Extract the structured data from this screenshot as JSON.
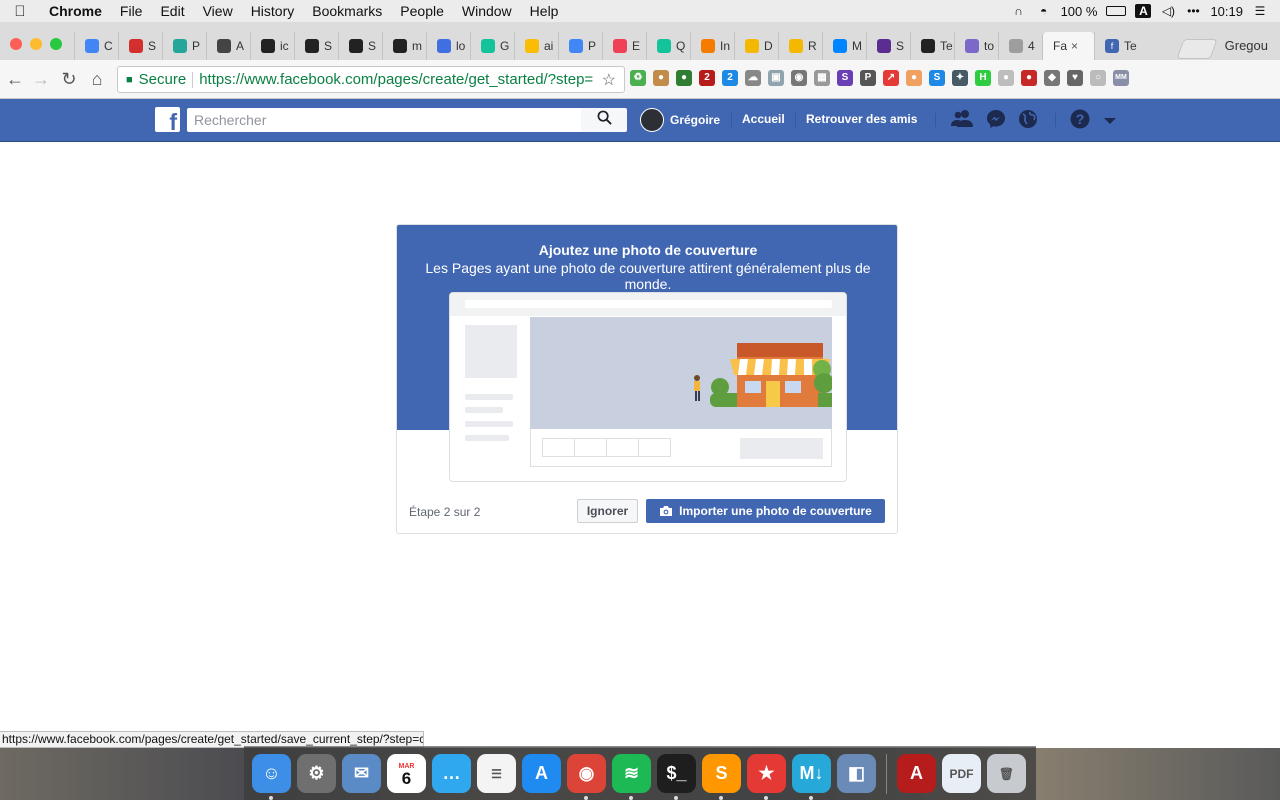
{
  "menubar": {
    "apple": "",
    "app_name": "Chrome",
    "items": [
      "File",
      "Edit",
      "View",
      "History",
      "Bookmarks",
      "People",
      "Window",
      "Help"
    ],
    "battery": "100 %",
    "input_source": "A",
    "clock": "10:19"
  },
  "browser": {
    "tabs": [
      {
        "label": "C",
        "icon": "google-docs-icon",
        "color": "#4285f4"
      },
      {
        "label": "S",
        "icon": "red-circle-icon",
        "color": "#d32f2f"
      },
      {
        "label": "P",
        "icon": "sheets-icon",
        "color": "#26a69a"
      },
      {
        "label": "A",
        "icon": "hat-icon",
        "color": "#444444"
      },
      {
        "label": "ic",
        "icon": "github-icon",
        "color": "#222222"
      },
      {
        "label": "S",
        "icon": "square-dark-icon",
        "color": "#222222"
      },
      {
        "label": "S",
        "icon": "square-dark-icon",
        "color": "#222222"
      },
      {
        "label": "m",
        "icon": "github-icon",
        "color": "#222222"
      },
      {
        "label": "lo",
        "icon": "circle-blue-icon",
        "color": "#3f6fe0"
      },
      {
        "label": "G",
        "icon": "grammarly-icon",
        "color": "#15c39a"
      },
      {
        "label": "ai",
        "icon": "google-drive-icon",
        "color": "#fbbc04"
      },
      {
        "label": "P",
        "icon": "google-docs-icon",
        "color": "#4285f4"
      },
      {
        "label": "E",
        "icon": "pocket-icon",
        "color": "#ef4056"
      },
      {
        "label": "Q",
        "icon": "grammarly-icon",
        "color": "#15c39a"
      },
      {
        "label": "In",
        "icon": "box-orange-icon",
        "color": "#f57c00"
      },
      {
        "label": "D",
        "icon": "box-yellow-icon",
        "color": "#f5b800"
      },
      {
        "label": "R",
        "icon": "box-yellow-icon",
        "color": "#f5b800"
      },
      {
        "label": "M",
        "icon": "messenger-icon",
        "color": "#0084ff"
      },
      {
        "label": "S",
        "icon": "purple-icon",
        "color": "#5c2d91"
      },
      {
        "label": "Te",
        "icon": "github-icon",
        "color": "#222222"
      },
      {
        "label": "to",
        "icon": "h-purple-icon",
        "color": "#7b68c8"
      },
      {
        "label": "4",
        "icon": "doc-outline-icon",
        "color": "#9e9e9e"
      }
    ],
    "active_tab": {
      "label": "Fa",
      "close": "×"
    },
    "last_tab": {
      "label": "Te",
      "icon": "facebook-icon",
      "color": "#4267b2"
    },
    "profile_name": "Gregou",
    "secure_label": "Secure",
    "url": "https://www.facebook.com/pages/create/get_started/?step=",
    "status_url": "https://www.facebook.com/pages/create/get_started/save_current_step/?step=cover",
    "extensions": [
      {
        "icon": "recycle-icon",
        "label": "♻",
        "color": "#4caf50"
      },
      {
        "icon": "cookie-icon",
        "label": "●",
        "color": "#c28b4a"
      },
      {
        "icon": "shield-green-icon",
        "label": "●",
        "color": "#2e7d32"
      },
      {
        "icon": "ublock-icon",
        "label": "2",
        "color": "#b71c1c"
      },
      {
        "icon": "s-badge-icon",
        "label": "2",
        "color": "#1e88e5"
      },
      {
        "icon": "cloud-icon",
        "label": "☁",
        "color": "#888888"
      },
      {
        "icon": "image-icon",
        "label": "▣",
        "color": "#90a4ae"
      },
      {
        "icon": "camera-icon",
        "label": "◉",
        "color": "#777777"
      },
      {
        "icon": "grid-icon",
        "label": "▦",
        "color": "#999999"
      },
      {
        "icon": "s-purple-icon",
        "label": "S",
        "color": "#6a3fb5"
      },
      {
        "icon": "p-gray-icon",
        "label": "P",
        "color": "#555555"
      },
      {
        "icon": "arrow-red-icon",
        "label": "↗",
        "color": "#e53935"
      },
      {
        "icon": "cat-icon",
        "label": "●",
        "color": "#f0a060"
      },
      {
        "icon": "s-blue-icon",
        "label": "S",
        "color": "#1e88e5"
      },
      {
        "icon": "runner-icon",
        "label": "✦",
        "color": "#455a64"
      },
      {
        "icon": "h-green-icon",
        "label": "H",
        "color": "#2ecc40"
      },
      {
        "icon": "shield-gray-icon",
        "label": "●",
        "color": "#bdbdbd"
      },
      {
        "icon": "rainbow-icon",
        "label": "●",
        "color": "#c62828"
      },
      {
        "icon": "layers-icon",
        "label": "◆",
        "color": "#777777"
      },
      {
        "icon": "pocket-icon",
        "label": "♥",
        "color": "#666666"
      },
      {
        "icon": "circle-outline-icon",
        "label": "○",
        "color": "#bbbbbb"
      },
      {
        "icon": "mm-ra-icon",
        "label": "MM",
        "color": "#8a8fa8"
      }
    ]
  },
  "facebook": {
    "logo": "f",
    "search_placeholder": "Rechercher",
    "user_name": "Grégoire",
    "nav_home": "Accueil",
    "nav_find_friends": "Retrouver des amis",
    "icons": [
      "friend-requests-icon",
      "messenger-icon",
      "notifications-globe-icon",
      "help-icon",
      "dropdown-arrow-icon"
    ]
  },
  "card": {
    "title": "Ajoutez une photo de couverture",
    "subtitle": "Les Pages ayant une photo de couverture attirent généralement plus de monde.",
    "step_text": "Étape 2 sur 2",
    "skip_button": "Ignorer",
    "upload_button": "Importer une photo de couverture"
  },
  "colors": {
    "facebook_blue": "#4267b2",
    "secure_green": "#0b8043"
  },
  "dock": {
    "calendar_month": "MAR",
    "calendar_day": "6",
    "apps": [
      {
        "name": "finder-icon",
        "color": "#3d8ee6",
        "label": "☺"
      },
      {
        "name": "system-preferences-icon",
        "color": "#6f6f6f",
        "label": "⚙"
      },
      {
        "name": "mail-icon",
        "color": "#5b8bc6",
        "label": "✉"
      },
      {
        "name": "calendar-icon",
        "color": "#ffffff",
        "label": ""
      },
      {
        "name": "messages-icon",
        "color": "#2fa8f0",
        "label": "…"
      },
      {
        "name": "reminders-icon",
        "color": "#f4f4f4",
        "label": "☰"
      },
      {
        "name": "app-store-icon",
        "color": "#1f8af0",
        "label": "A"
      },
      {
        "name": "chrome-icon",
        "color": "#db4437",
        "label": "◉"
      },
      {
        "name": "spotify-icon",
        "color": "#1db954",
        "label": "≋"
      },
      {
        "name": "terminal-icon",
        "color": "#1e1e1e",
        "label": "$_"
      },
      {
        "name": "sublime-text-icon",
        "color": "#ff9800",
        "label": "S"
      },
      {
        "name": "wunderlist-icon",
        "color": "#e53935",
        "label": "★"
      },
      {
        "name": "markdown-icon",
        "color": "#26a8d8",
        "label": "M↓"
      },
      {
        "name": "preview-icon",
        "color": "#6a8bb8",
        "label": "◧"
      },
      {
        "name": "acrobat-icon",
        "color": "#b71c1c",
        "label": "A"
      },
      {
        "name": "pdf-document-icon",
        "color": "#e8eef5",
        "label": "PDF"
      },
      {
        "name": "trash-icon",
        "color": "#c7cbd0",
        "label": "🗑"
      }
    ]
  }
}
